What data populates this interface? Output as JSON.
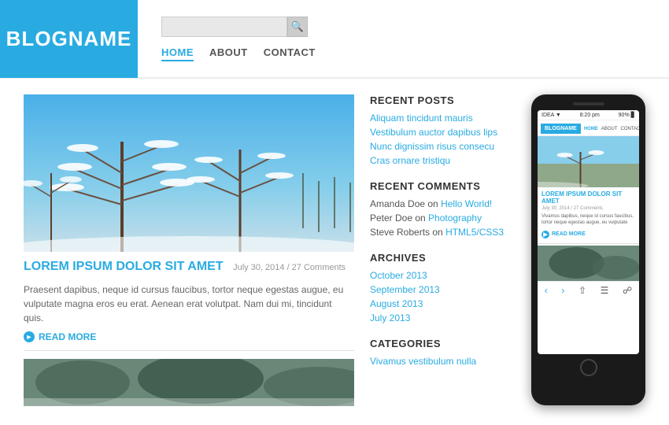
{
  "header": {
    "logo": "BLOGNAME",
    "search_placeholder": "",
    "nav": [
      {
        "label": "HOME",
        "active": true
      },
      {
        "label": "ABOUT",
        "active": false
      },
      {
        "label": "CONTACT",
        "active": false
      }
    ]
  },
  "blog": {
    "post": {
      "title": "LOREM IPSUM DOLOR SIT AMET",
      "date": "July 30, 2014 / 27 Comments",
      "excerpt": "Praesent dapibus, neque id cursus faucibus, tortor neque egestas augue, eu vulputate magna eros eu erat. Aenean erat volutpat. Nam dui mi, tincidunt quis.",
      "read_more": "READ MORE"
    }
  },
  "sidebar": {
    "recent_posts_title": "RECENT POSTS",
    "recent_posts": [
      "Aliquam tincidunt mauris",
      "Vestibulum auctor dapibus lips",
      "Nunc dignissim risus consecu",
      "Cras ornare tristiqu"
    ],
    "recent_comments_title": "RECENT COMMENTS",
    "recent_comments": [
      {
        "author": "Amanda Doe",
        "on": "Hello World!"
      },
      {
        "author": "Peter Doe",
        "on": "Photography"
      },
      {
        "author": "Steve Roberts",
        "on": "HTML5/CSS3"
      }
    ],
    "archives_title": "ARCHIVES",
    "archives": [
      "October 2013",
      "September 2013",
      "August 2013",
      "July 2013"
    ],
    "categories_title": "CATEGORIES",
    "categories": [
      "Vivamus vestibulum nulla"
    ]
  },
  "phone": {
    "status": "IDEA ▼",
    "time": "8:20 pm",
    "battery": "90%",
    "logo": "BLOGNAME",
    "nav": [
      "HOME",
      "ABOUT",
      "CONTACT"
    ],
    "post_title": "LOREM IPSUM DOLOR SIT AMET",
    "post_date": "July 30, 2014 / 27 Comments",
    "post_text": "Vivamus dapibus, neque id cursus faucibus, tortor neque egestas augue, eu vulputate",
    "read_more": "READ MORE"
  },
  "colors": {
    "accent": "#29abe2",
    "text_dark": "#333",
    "text_muted": "#999"
  }
}
